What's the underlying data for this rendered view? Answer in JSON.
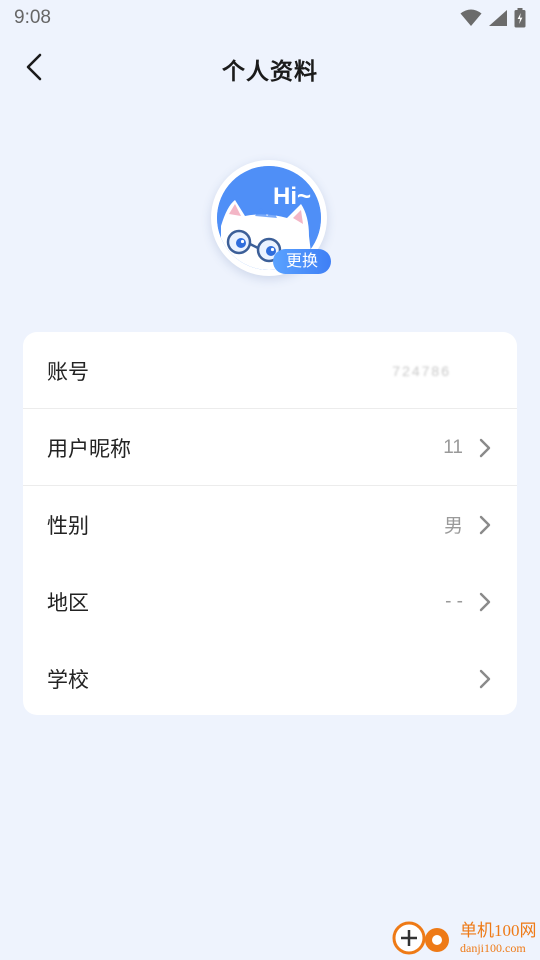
{
  "status_bar": {
    "time": "9:08",
    "icons": [
      "wifi-icon",
      "signal-icon",
      "battery-icon"
    ]
  },
  "header": {
    "title": "个人资料",
    "back_icon": "chevron-left-icon"
  },
  "avatar": {
    "text": "Hi~",
    "change_label": "更换"
  },
  "profile_rows": [
    {
      "label": "账号",
      "value": "724786",
      "has_arrow": false
    },
    {
      "label": "用户昵称",
      "value": "11",
      "has_arrow": true
    },
    {
      "label": "性别",
      "value": "男",
      "has_arrow": true
    },
    {
      "label": "地区",
      "value": "- -",
      "has_arrow": true
    },
    {
      "label": "学校",
      "value": "",
      "has_arrow": true
    }
  ],
  "watermark": {
    "title": "单机100网",
    "subtitle": "danji100.com"
  },
  "colors": {
    "background": "#eef3fd",
    "accent": "#4f8ff7",
    "watermark": "#ee7a16"
  }
}
